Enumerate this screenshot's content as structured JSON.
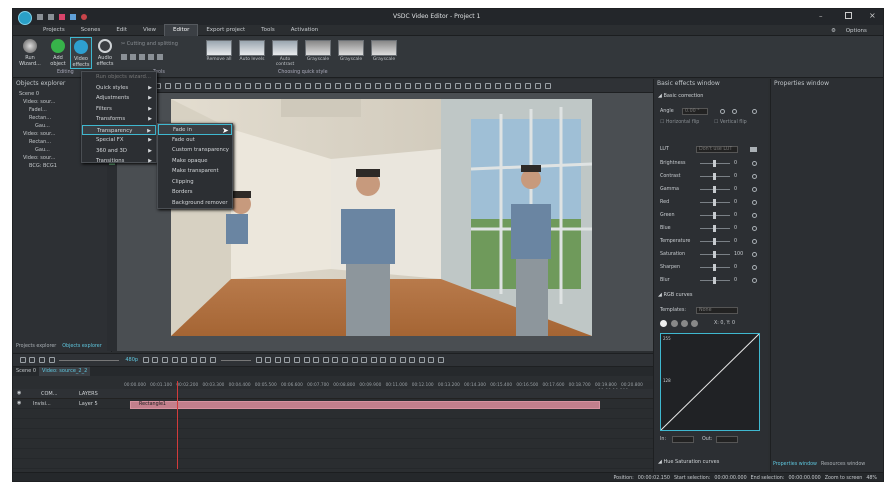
{
  "app": {
    "title": "VSDC Video Editor - Project 1",
    "options": "Options"
  },
  "menu": [
    "Projects",
    "Scenes",
    "Edit",
    "View",
    "Editor",
    "Export project",
    "Tools",
    "Activation"
  ],
  "active_menu": "Editor",
  "ribbon": {
    "run_wizard": "Run Wizard...",
    "add_object": "Add object",
    "video_effects": "Video effects",
    "audio_effects": "Audio effects",
    "cutting": "Cutting and splitting",
    "editing": "Editing",
    "tools": "Tools",
    "quick_style_title": "Choosing quick style",
    "quick_styles": [
      "Remove all",
      "Auto levels",
      "Auto contrast",
      "Grayscale",
      "Grayscale",
      "Grayscale"
    ]
  },
  "objects_explorer": {
    "title": "Objects explorer",
    "tree": [
      "Scene 0",
      "Video: sour...",
      "Fadel...",
      "Rectan...",
      "Gau...",
      "Video: sour...",
      "Rectan...",
      "Gau...",
      "Video: sour...",
      "BCG: BCG1"
    ]
  },
  "video_effects_menu": {
    "header": "Run objects wizard...",
    "items": [
      "Quick styles",
      "Adjustments",
      "Filters",
      "Transforms",
      "Transparency",
      "Special FX",
      "360 and 3D",
      "Transitions"
    ],
    "highlighted": "Transparency"
  },
  "transparency_submenu": {
    "items": [
      "Fade in",
      "Fade out",
      "Custom transparency",
      "Make opaque",
      "Make transparent",
      "Clipping",
      "Borders",
      "Background remover"
    ],
    "highlighted": "Fade in"
  },
  "bottom_tabs": [
    "Projects explorer",
    "Objects explorer"
  ],
  "timeline": {
    "zoom": "480p",
    "tabs": [
      "Scene 0",
      "Video: source_2_2"
    ],
    "header_com": "COM...",
    "header_layers": "LAYERS",
    "track_name": "Invisi...",
    "track_layer": "Layer 5",
    "clip_label": "Rectangle1",
    "ruler": [
      "00:00.000",
      "00:01.100",
      "00:02.200",
      "00:03.300",
      "00:04.400",
      "00:05.500",
      "00:06.600",
      "00:07.700",
      "00:08.800",
      "00:09.900",
      "00:11.000",
      "00:12.100",
      "00:13.200",
      "00:14.300",
      "00:15.400",
      "00:16.500",
      "00:17.600",
      "00:18.700",
      "00:19.800",
      "00:20.800"
    ],
    "end_time": "00:00:19.800"
  },
  "basic_effects": {
    "title": "Basic effects window",
    "color_correction": "Basic correction",
    "angle_label": "Angle",
    "angle_value": "0.00 °",
    "hflip": "Horizontal flip",
    "vflip": "Vertical flip",
    "lut_label": "LUT",
    "lut_value": "Don't use LUT",
    "adjust": [
      {
        "name": "Brightness",
        "value": "0"
      },
      {
        "name": "Contrast",
        "value": "0"
      },
      {
        "name": "Gamma",
        "value": "0"
      },
      {
        "name": "Red",
        "value": "0"
      },
      {
        "name": "Green",
        "value": "0"
      },
      {
        "name": "Blue",
        "value": "0"
      },
      {
        "name": "Temperature",
        "value": "0"
      },
      {
        "name": "Saturation",
        "value": "100"
      },
      {
        "name": "Sharpen",
        "value": "0"
      },
      {
        "name": "Blur",
        "value": "0"
      }
    ],
    "rgb_curves": "RGB curves",
    "templates_label": "Templates:",
    "templates_value": "None",
    "coords": "X: 0, Y: 0",
    "curve_top": "255",
    "curve_mid": "128",
    "in_label": "In:",
    "out_label": "Out:",
    "hue_curves": "Hue Saturation curves"
  },
  "properties": {
    "title": "Properties window",
    "tabs": [
      "Properties window",
      "Resources window"
    ]
  },
  "status": {
    "position_label": "Position:",
    "position": "00:00:02.150",
    "start_label": "Start selection:",
    "start": "00:00:00.000",
    "end_label": "End selection:",
    "end": "00:00:00.000",
    "zoom_label": "Zoom to screen",
    "zoom": "48%"
  }
}
